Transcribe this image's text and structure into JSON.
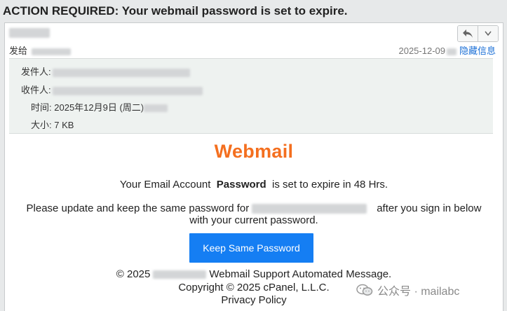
{
  "email": {
    "subject": "ACTION REQUIRED: Your webmail password is set to expire."
  },
  "header": {
    "send_to_label": "发给",
    "date": "2025-12-09",
    "hide_info_label": "隐藏信息",
    "reply_icon": "reply-icon",
    "more_icon": "chevron-down-icon"
  },
  "meta": {
    "sender_label": "发件人:",
    "recipient_label": "收件人:",
    "time_label": "时间:",
    "time_value": "2025年12月9日 (周二)",
    "size_label": "大小:",
    "size_value": "7 KB"
  },
  "content": {
    "logo": "Webmail",
    "line1_pre": "Your Email Account",
    "line1_bold": "Password",
    "line1_post": "is set to expire in 48 Hrs.",
    "line2_pre": "Please update and keep the same password for",
    "line2_post": "after you sign in below",
    "line3": "with your current password.",
    "cta_label": "Keep Same Password",
    "footer_year": "© 2025",
    "footer_msg": "Webmail Support Automated Message.",
    "copyright": "Copyright © 2025 cPanel, L.L.C.",
    "privacy": "Privacy Policy"
  },
  "watermark": {
    "text": "公众号 · mailabc",
    "icon": "wechat-icon"
  },
  "colors": {
    "logo": "#f46f1f",
    "cta": "#157ef3",
    "link": "#1a6fd6"
  }
}
